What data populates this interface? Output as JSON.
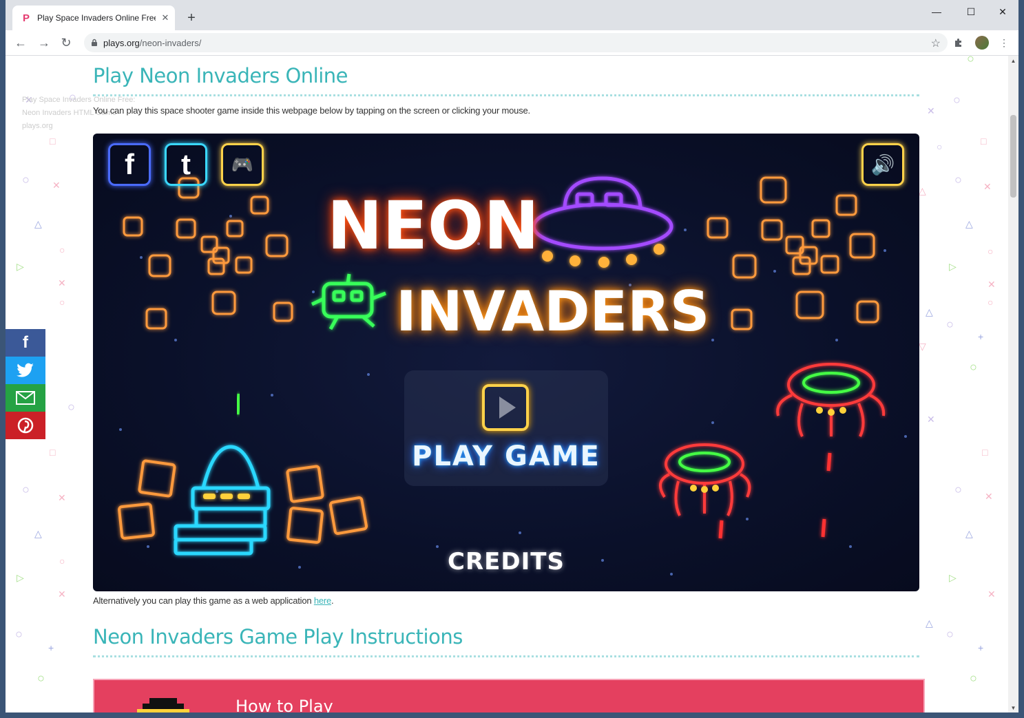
{
  "browser": {
    "tab_title": "Play Space Invaders Online Free: ",
    "tab_favicon": "P",
    "url_domain": "plays.org",
    "url_path": "/neon-invaders/",
    "ghost_suggest": [
      "Play Space Invaders Online Free:",
      "Neon Invaders HTML Game",
      "plays.org"
    ]
  },
  "page": {
    "heading1": "Play Neon Invaders Online",
    "intro": "You can play this space shooter game inside this webpage below by tapping on the screen or clicking your mouse.",
    "alt_text_before": "Alternatively you can play this game as a web application ",
    "alt_link": "here",
    "alt_text_after": ".",
    "heading2": "Neon Invaders Game Play Instructions",
    "howto_title": "How to Play"
  },
  "game": {
    "title_line1": "NEON",
    "title_line2": "INVADERS",
    "play_label": "PLAY GAME",
    "credits_label": "CREDITS",
    "fb_letter": "f",
    "tw_letter": "t"
  },
  "share": {
    "facebook": "f",
    "twitter": "twitter-icon",
    "email": "email-icon",
    "pinterest": "pinterest-icon"
  },
  "colors": {
    "accent": "#3ab5b8",
    "facebook": "#3b5998",
    "twitter": "#1da1f2",
    "email": "#25a244",
    "pinterest": "#cb2027",
    "howto_bg": "#e4405f"
  }
}
